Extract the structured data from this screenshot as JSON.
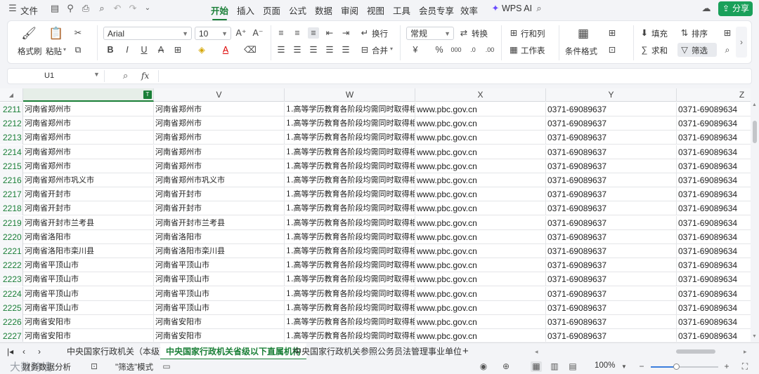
{
  "menu": {
    "file": "文件",
    "tabs": [
      "开始",
      "插入",
      "页面",
      "公式",
      "数据",
      "审阅",
      "视图",
      "工具",
      "会员专享",
      "效率"
    ],
    "ai": "WPS AI",
    "share": "分享"
  },
  "ribbon": {
    "format_painter": "格式刷",
    "paste": "粘贴",
    "font_name": "Arial",
    "font_size": "10",
    "wrap": "换行",
    "merge": "合并",
    "number_format": "常规",
    "convert": "转换",
    "rows_cols": "行和列",
    "worksheet": "工作表",
    "conditional_format": "条件格式",
    "fill": "填充",
    "sort": "排序",
    "sum": "求和",
    "filter": "筛选"
  },
  "formula_bar": {
    "cell_ref": "U1",
    "fx": "fx",
    "value": ""
  },
  "columns": [
    "V",
    "W",
    "X",
    "Y",
    "Z"
  ],
  "rows": [
    {
      "n": "2211",
      "u": "河南省郑州市",
      "v": "河南省郑州市",
      "w": "1.高等学历教育各阶段均需同时取得相",
      "x": "www.pbc.gov.cn",
      "y": "0371-69089637",
      "z": "0371-69089634"
    },
    {
      "n": "2212",
      "u": "河南省郑州市",
      "v": "河南省郑州市",
      "w": "1.高等学历教育各阶段均需同时取得相",
      "x": "www.pbc.gov.cn",
      "y": "0371-69089637",
      "z": "0371-69089634"
    },
    {
      "n": "2213",
      "u": "河南省郑州市",
      "v": "河南省郑州市",
      "w": "1.高等学历教育各阶段均需同时取得相",
      "x": "www.pbc.gov.cn",
      "y": "0371-69089637",
      "z": "0371-69089634"
    },
    {
      "n": "2214",
      "u": "河南省郑州市",
      "v": "河南省郑州市",
      "w": "1.高等学历教育各阶段均需同时取得相",
      "x": "www.pbc.gov.cn",
      "y": "0371-69089637",
      "z": "0371-69089634"
    },
    {
      "n": "2215",
      "u": "河南省郑州市",
      "v": "河南省郑州市",
      "w": "1.高等学历教育各阶段均需同时取得相",
      "x": "www.pbc.gov.cn",
      "y": "0371-69089637",
      "z": "0371-69089634"
    },
    {
      "n": "2216",
      "u": "河南省郑州市巩义市",
      "v": "河南省郑州市巩义市",
      "w": "1.高等学历教育各阶段均需同时取得相",
      "x": "www.pbc.gov.cn",
      "y": "0371-69089637",
      "z": "0371-69089634"
    },
    {
      "n": "2217",
      "u": "河南省开封市",
      "v": "河南省开封市",
      "w": "1.高等学历教育各阶段均需同时取得相",
      "x": "www.pbc.gov.cn",
      "y": "0371-69089637",
      "z": "0371-69089634"
    },
    {
      "n": "2218",
      "u": "河南省开封市",
      "v": "河南省开封市",
      "w": "1.高等学历教育各阶段均需同时取得相",
      "x": "www.pbc.gov.cn",
      "y": "0371-69089637",
      "z": "0371-69089634"
    },
    {
      "n": "2219",
      "u": "河南省开封市兰考县",
      "v": "河南省开封市兰考县",
      "w": "1.高等学历教育各阶段均需同时取得相",
      "x": "www.pbc.gov.cn",
      "y": "0371-69089637",
      "z": "0371-69089634"
    },
    {
      "n": "2220",
      "u": "河南省洛阳市",
      "v": "河南省洛阳市",
      "w": "1.高等学历教育各阶段均需同时取得相",
      "x": "www.pbc.gov.cn",
      "y": "0371-69089637",
      "z": "0371-69089634"
    },
    {
      "n": "2221",
      "u": "河南省洛阳市栾川县",
      "v": "河南省洛阳市栾川县",
      "w": "1.高等学历教育各阶段均需同时取得相",
      "x": "www.pbc.gov.cn",
      "y": "0371-69089637",
      "z": "0371-69089634"
    },
    {
      "n": "2222",
      "u": "河南省平顶山市",
      "v": "河南省平顶山市",
      "w": "1.高等学历教育各阶段均需同时取得相",
      "x": "www.pbc.gov.cn",
      "y": "0371-69089637",
      "z": "0371-69089634"
    },
    {
      "n": "2223",
      "u": "河南省平顶山市",
      "v": "河南省平顶山市",
      "w": "1.高等学历教育各阶段均需同时取得相",
      "x": "www.pbc.gov.cn",
      "y": "0371-69089637",
      "z": "0371-69089634"
    },
    {
      "n": "2224",
      "u": "河南省平顶山市",
      "v": "河南省平顶山市",
      "w": "1.高等学历教育各阶段均需同时取得相",
      "x": "www.pbc.gov.cn",
      "y": "0371-69089637",
      "z": "0371-69089634"
    },
    {
      "n": "2225",
      "u": "河南省平顶山市",
      "v": "河南省平顶山市",
      "w": "1.高等学历教育各阶段均需同时取得相",
      "x": "www.pbc.gov.cn",
      "y": "0371-69089637",
      "z": "0371-69089634"
    },
    {
      "n": "2226",
      "u": "河南省安阳市",
      "v": "河南省安阳市",
      "w": "1.高等学历教育各阶段均需同时取得相",
      "x": "www.pbc.gov.cn",
      "y": "0371-69089637",
      "z": "0371-69089634"
    },
    {
      "n": "2227",
      "u": "河南省安阳市",
      "v": "河南省安阳市",
      "w": "1.高等学历教育各阶段均需同时取得相",
      "x": "www.pbc.gov.cn",
      "y": "0371-69089637",
      "z": "0371-69089634"
    }
  ],
  "sheet_tabs": [
    "中央国家行政机关（本级）",
    "中央国家行政机关省级以下直属机构",
    "中央国家行政机关参照公务员法管理事业单位"
  ],
  "status": {
    "watermark": "大数跨境",
    "analysis": "财务数据分析",
    "filter_mode": "\"筛选\"模式",
    "zoom": "100%"
  },
  "colors": {
    "accent": "#1a7f37",
    "share": "#1aa05a"
  }
}
